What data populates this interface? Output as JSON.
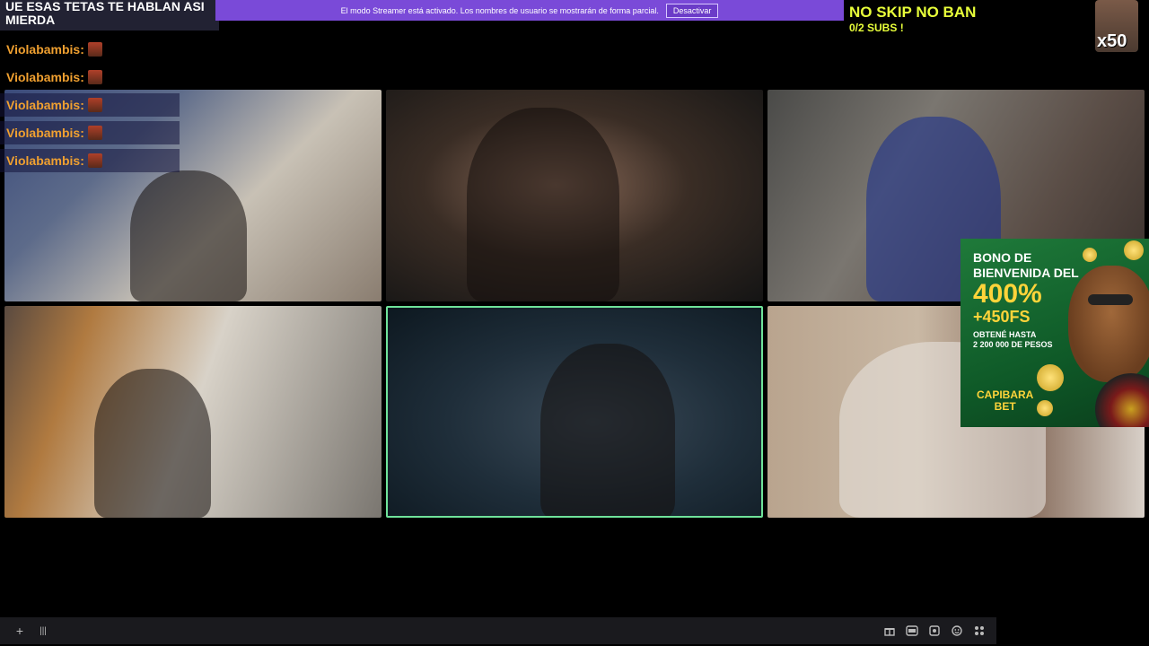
{
  "chat_top_text": "UE ESAS TETAS TE HABLAN ASI MIERDA",
  "banner": {
    "text": "El modo Streamer está activado. Los nombres de usuario se mostrarán de forma parcial.",
    "button": "Desactivar"
  },
  "goal": {
    "title": "NO SKIP NO BAN",
    "subs": "0/2 SUBS !"
  },
  "multiplier": "x50",
  "chat": [
    {
      "user": "Violabambis:"
    },
    {
      "user": "Violabambis:"
    },
    {
      "user": "Violabambis:"
    },
    {
      "user": "Violabambis:"
    },
    {
      "user": "Violabambis:"
    }
  ],
  "ad": {
    "line1": "BONO DE",
    "line2": "BIENVENIDA DEL",
    "percent": "400%",
    "fs": "+450FS",
    "small1": "OBTENÉ HASTA",
    "small2": "2 200 000 DE PESOS",
    "brand1": "CAPIBARA",
    "brand2": "BET"
  },
  "bottom": {
    "add_icon": "+",
    "bars_icon": "|||"
  },
  "colors": {
    "banner": "#7a4ad8",
    "goal": "#e8ff3a",
    "chat_user": "#f0a030",
    "active_border": "#6fe39a"
  }
}
